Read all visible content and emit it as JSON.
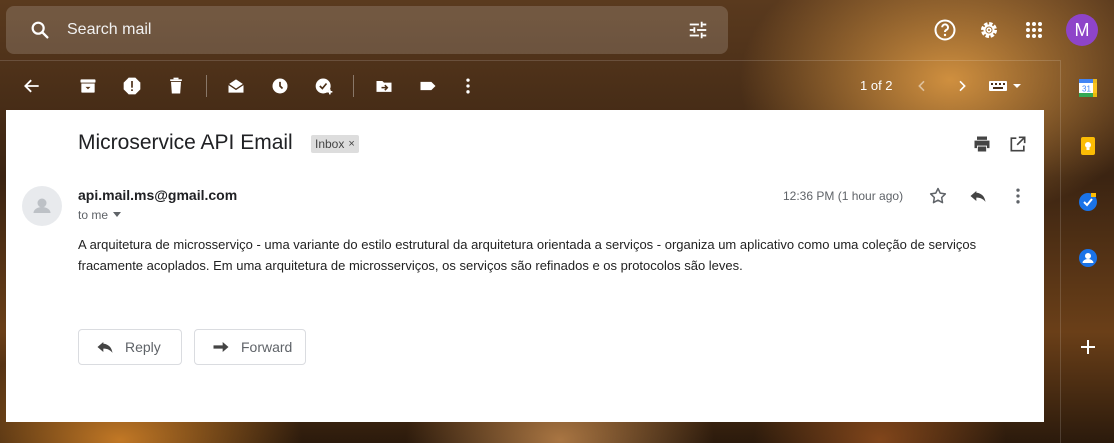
{
  "search": {
    "placeholder": "Search mail"
  },
  "header": {
    "avatar_letter": "M",
    "avatar_color": "#8e44c9"
  },
  "toolbar": {
    "pager": "1 of 2"
  },
  "message": {
    "subject": "Microservice API Email",
    "label": "Inbox",
    "label_remove": "×",
    "sender": "api.mail.ms@gmail.com",
    "to": "to me",
    "time": "12:36 PM (1 hour ago)",
    "body": "A arquitetura de microsserviço - uma variante do estilo estrutural da arquitetura orientada a serviços - organiza um aplicativo como uma coleção de serviços fracamente acoplados. Em uma arquitetura de microsserviços, os serviços são refinados e os protocolos são leves."
  },
  "actions": {
    "reply": "Reply",
    "forward": "Forward"
  },
  "colors": {
    "panel": "#ffffff",
    "text_primary": "#202124",
    "text_secondary": "#5f6368"
  }
}
